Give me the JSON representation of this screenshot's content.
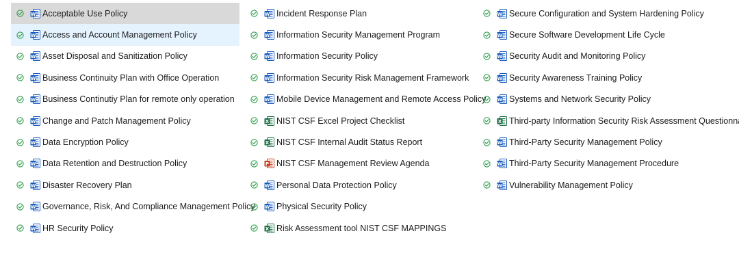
{
  "files": {
    "column1": [
      {
        "name": "Acceptable Use Policy",
        "type": "word",
        "status": "synced"
      },
      {
        "name": "Access and Account Management Policy",
        "type": "word",
        "status": "synced"
      },
      {
        "name": "Asset Disposal and Sanitization Policy",
        "type": "word",
        "status": "synced"
      },
      {
        "name": "Business Continuity Plan with Office Operation",
        "type": "word",
        "status": "synced"
      },
      {
        "name": "Business Continutiy Plan for remote only operation",
        "type": "word",
        "status": "synced"
      },
      {
        "name": "Change and Patch Management Policy",
        "type": "word",
        "status": "synced"
      },
      {
        "name": "Data Encryption Policy",
        "type": "word",
        "status": "synced"
      },
      {
        "name": "Data Retention and Destruction Policy",
        "type": "word",
        "status": "synced"
      },
      {
        "name": "Disaster Recovery Plan",
        "type": "word",
        "status": "synced"
      },
      {
        "name": "Governance, Risk, And Compliance Management Policy",
        "type": "word",
        "status": "synced"
      },
      {
        "name": "HR Security Policy",
        "type": "word",
        "status": "synced"
      }
    ],
    "column2": [
      {
        "name": "Incident Response Plan",
        "type": "word",
        "status": "synced"
      },
      {
        "name": "Information Security Management Program",
        "type": "word",
        "status": "synced"
      },
      {
        "name": "Information Security Policy",
        "type": "word",
        "status": "synced"
      },
      {
        "name": "Information Security Risk Management Framework",
        "type": "word",
        "status": "synced"
      },
      {
        "name": "Mobile Device Management and Remote Access Policy",
        "type": "word",
        "status": "synced"
      },
      {
        "name": "NIST CSF Excel Project Checklist",
        "type": "excel",
        "status": "synced"
      },
      {
        "name": "NIST CSF Internal Audit Status Report",
        "type": "excel",
        "status": "synced"
      },
      {
        "name": "NIST CSF Management Review Agenda",
        "type": "powerpoint",
        "status": "synced"
      },
      {
        "name": "Personal Data Protection Policy",
        "type": "word",
        "status": "synced"
      },
      {
        "name": "Physical Security Policy",
        "type": "word",
        "status": "synced"
      },
      {
        "name": "Risk Assessment tool NIST CSF MAPPINGS",
        "type": "excel",
        "status": "synced"
      }
    ],
    "column3": [
      {
        "name": "Secure Configuration and System Hardening Policy",
        "type": "word",
        "status": "synced"
      },
      {
        "name": "Secure Software Development Life Cycle",
        "type": "word",
        "status": "synced"
      },
      {
        "name": "Security Audit and Monitoring Policy",
        "type": "word",
        "status": "synced"
      },
      {
        "name": "Security Awareness Training Policy",
        "type": "word",
        "status": "synced"
      },
      {
        "name": "Systems and Network Security Policy",
        "type": "word",
        "status": "synced"
      },
      {
        "name": "Third-party Information Security Risk Assessment Questionnaire",
        "type": "excel",
        "status": "synced"
      },
      {
        "name": "Third-Party Security Management Policy",
        "type": "word",
        "status": "synced"
      },
      {
        "name": "Third-Party Security Management Procedure",
        "type": "word",
        "status": "synced"
      },
      {
        "name": "Vulnerability Management Policy",
        "type": "word",
        "status": "synced"
      }
    ]
  },
  "state": {
    "selected": "Acceptable Use Policy",
    "hovered": "Access and Account Management Policy"
  },
  "icons": {
    "status": "sync-status-check-icon",
    "word": "word-document-icon",
    "excel": "excel-workbook-icon",
    "powerpoint": "powerpoint-presentation-icon"
  },
  "colors": {
    "status_green": "#2e9e4a",
    "word_blue": "#185abd",
    "excel_green": "#1d7044",
    "powerpoint_red": "#c43e1c",
    "selected_bg": "#d9d9d9",
    "hover_bg": "#e5f3ff"
  }
}
